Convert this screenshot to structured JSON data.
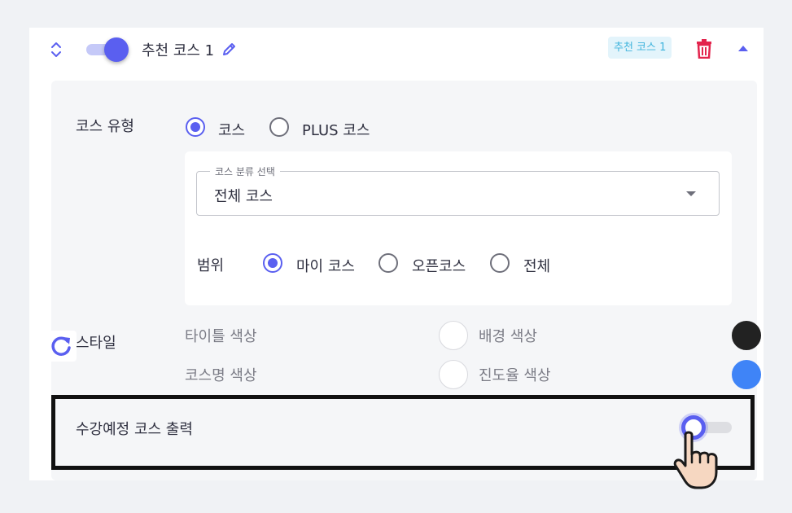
{
  "header": {
    "course_title": "추천 코스 1",
    "badge": "추천 코스 1",
    "enabled": true
  },
  "course_type": {
    "label": "코스 유형",
    "options": [
      "코스",
      "PLUS 코스"
    ],
    "selected": "코스"
  },
  "category_select": {
    "legend": "코스 분류 선택",
    "value": "전체 코스"
  },
  "scope": {
    "label": "범위",
    "options": [
      "마이 코스",
      "오픈코스",
      "전체"
    ],
    "selected": "마이 코스"
  },
  "style": {
    "label": "스타일",
    "title_color_label": "타이틀 색상",
    "title_color": "#ffffff",
    "background_color_label": "배경 색상",
    "background_color": "#222222",
    "course_name_color_label": "코스명 색상",
    "course_name_color": "#ffffff",
    "progress_color_label": "진도율 색상",
    "progress_color": "#3f84f7"
  },
  "upcoming": {
    "label": "수강예정 코스 출력",
    "enabled": false
  },
  "colors": {
    "accent": "#5a5ff0",
    "delete": "#e3244d",
    "badge_text": "#3eb3dc"
  },
  "icons": [
    "drag-handle-icon",
    "pencil-icon",
    "trash-icon",
    "chevron-up-icon",
    "refresh-icon",
    "pointing-hand-icon"
  ]
}
